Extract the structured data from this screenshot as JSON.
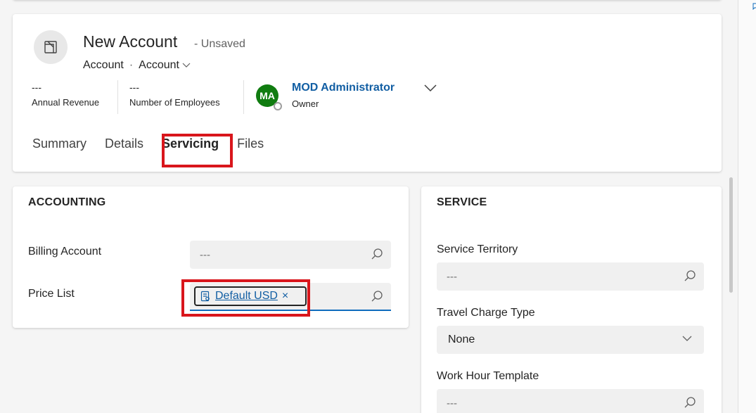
{
  "record": {
    "title": "New Account",
    "status": "- Unsaved",
    "entity": "Account",
    "separator": "·",
    "form": "Account"
  },
  "metrics": [
    {
      "value": "---",
      "label": "Annual Revenue"
    },
    {
      "value": "---",
      "label": "Number of Employees"
    }
  ],
  "owner": {
    "initials": "MA",
    "name": "MOD Administrator",
    "label": "Owner",
    "avatar_color": "#107c10"
  },
  "tabs": [
    "Summary",
    "Details",
    "Servicing",
    "Files"
  ],
  "active_tab": "Servicing",
  "accounting": {
    "title": "ACCOUNTING",
    "billing_account": {
      "label": "Billing Account",
      "value": "---"
    },
    "price_list": {
      "label": "Price List",
      "value": "Default USD",
      "remove": "×"
    }
  },
  "service": {
    "title": "SERVICE",
    "service_territory": {
      "label": "Service Territory",
      "value": "---"
    },
    "travel_charge_type": {
      "label": "Travel Charge Type",
      "value": "None"
    },
    "work_hour_template": {
      "label": "Work Hour Template",
      "value": "---"
    }
  },
  "colors": {
    "highlight": "#d9161c",
    "link": "#115ea3",
    "accent": "#0f6cbd"
  }
}
